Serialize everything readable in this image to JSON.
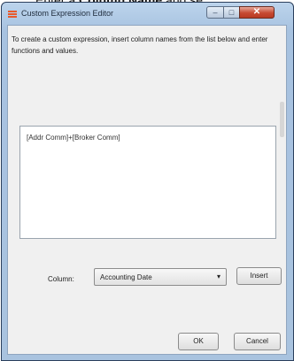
{
  "background_caption": {
    "prefix": "Enter a ",
    "bold": "Column Name",
    "suffix": " and se"
  },
  "window": {
    "title": "Custom Expression Editor",
    "controls": {
      "minimize": "–",
      "maximize": "□",
      "close": "✕"
    }
  },
  "instructions": "To create a custom expression, insert column names from the list below and enter functions and values.",
  "expression": "[Addr Comm]+[Broker Comm]",
  "column": {
    "label": "Column:",
    "selected": "Accounting Date"
  },
  "buttons": {
    "insert": "Insert",
    "ok": "OK",
    "cancel": "Cancel"
  },
  "colors": {
    "accent": "#e8592c",
    "frame": "#a9c3df",
    "close": "#c74a32"
  }
}
